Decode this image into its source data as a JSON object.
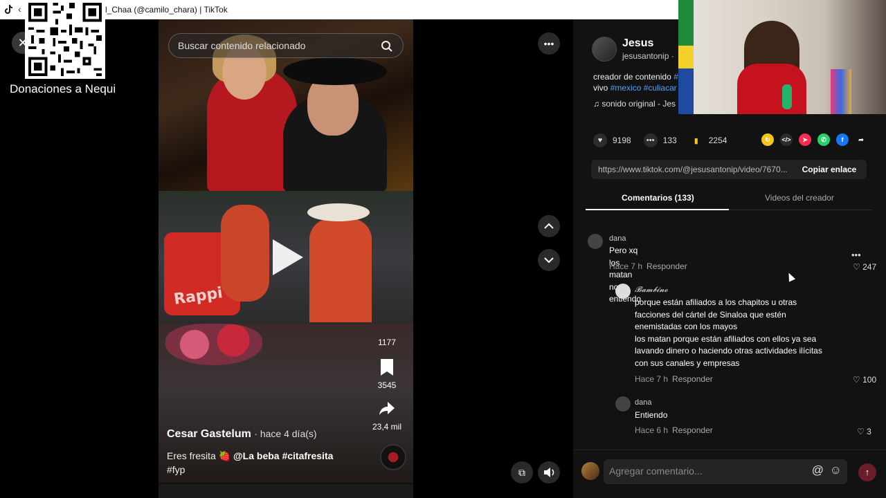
{
  "browser": {
    "tab_title": "l_Chaa (@camilo_chara) | TikTok",
    "back_glyph": "‹",
    "tiktok_icon": "tiktok-icon"
  },
  "overlay": {
    "donation_label": "Donaciones a Nequi",
    "close_glyph": "✕"
  },
  "feed": {
    "search_placeholder": "Buscar contenido relacionado",
    "video3": {
      "comments_count": "1177",
      "saves_count": "3545",
      "shares_count": "23,4 mil",
      "author": "Cesar Gastelum",
      "time": "· hace 4 día(s)",
      "caption_prefix": "Eres fresita 🍓",
      "mention": "@La beba",
      "hashtags": "#citafresita",
      "hashtag2": "#fyp"
    },
    "rappi_text": "Rappi"
  },
  "controls": {
    "more_glyph": "•••",
    "up_glyph": "︿",
    "down_glyph": "﹀",
    "volume_glyph": "🔊",
    "pip_glyph": "⧉"
  },
  "creator": {
    "name": "Jesus",
    "handle": "jesusantonip · ",
    "description_line1": "creador de contenido ",
    "description_tag1": "#",
    "description_line2": "vivo ",
    "description_tag2": "#mexico",
    "description_tag3": "#culiacar",
    "sound": "♫  sonido original - Jes"
  },
  "stats": {
    "likes": "9198",
    "comments": "133",
    "saves": "2254"
  },
  "share_icons": [
    {
      "name": "repost-icon",
      "color": "#f5c518",
      "glyph": "↻"
    },
    {
      "name": "embed-icon",
      "color": "#2c2c2c",
      "glyph": "</>"
    },
    {
      "name": "send-icon",
      "color": "#fe2c55",
      "glyph": "➤"
    },
    {
      "name": "whatsapp-icon",
      "color": "#25d366",
      "glyph": "✆"
    },
    {
      "name": "facebook-icon",
      "color": "#1877f2",
      "glyph": "f"
    },
    {
      "name": "share-icon",
      "color": "#121212",
      "glyph": "➦"
    }
  ],
  "link": {
    "url": "https://www.tiktok.com/@jesusantonip/video/7670...",
    "copy_label": "Copiar enlace"
  },
  "tabs": {
    "comments": "Comentarios (133)",
    "creator_videos": "Videos del creador"
  },
  "comments": [
    {
      "user": "dana",
      "text": "Pero xq los matan no entiendo",
      "time": "Hace 7 h",
      "reply": "Responder",
      "likes": "247",
      "more": "•••"
    },
    {
      "user": "𝓑𝓪𝓶𝓫𝓲𝓷𝓸",
      "text_lines": [
        "porque están afiliados a los chapitos u otras",
        "facciones del cártel de Sinaloa que estén",
        "enemistadas con los mayos",
        "los matan porque están afiliados con ellos ya sea",
        "lavando dinero o haciendo otras actividades ilícitas",
        "con sus canales y empresas"
      ],
      "time": "Hace 7 h",
      "reply": "Responder",
      "likes": "100"
    },
    {
      "user": "dana",
      "text": "Entiendo",
      "time": "Hace 6 h",
      "reply": "Responder",
      "likes": "3"
    }
  ],
  "composer": {
    "placeholder": "Agregar comentario...",
    "at_glyph": "@",
    "emoji_glyph": "☺",
    "send_glyph": "↑"
  },
  "colors": {
    "accent_link": "#4fa3ff",
    "tiktok_red": "#fe2c55",
    "bookmark_yellow": "#f5c518"
  }
}
